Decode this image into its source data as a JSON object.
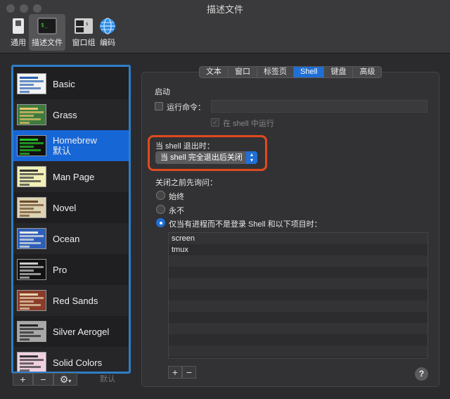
{
  "window": {
    "title": "描述文件"
  },
  "toolbar": [
    {
      "label": "通用",
      "icon": "general-switch-icon"
    },
    {
      "label": "描述文件",
      "icon": "terminal-profile-icon",
      "active": true
    },
    {
      "label": "窗口组",
      "icon": "window-group-icon"
    },
    {
      "label": "编码",
      "icon": "globe-icon"
    }
  ],
  "profiles": [
    {
      "name": "Basic",
      "bg": "#f2f2f2",
      "fg": "#2a5fb0"
    },
    {
      "name": "Grass",
      "bg": "#3f7a3f",
      "fg": "#e8c46a"
    },
    {
      "name": "Homebrew",
      "sub": "默认",
      "bg": "#111111",
      "fg": "#29c429",
      "selected": true
    },
    {
      "name": "Man Page",
      "bg": "#f2efb8",
      "fg": "#333333"
    },
    {
      "name": "Novel",
      "bg": "#ddd2b4",
      "fg": "#6b4a2a"
    },
    {
      "name": "Ocean",
      "bg": "#2e5fb8",
      "fg": "#e8e8e8"
    },
    {
      "name": "Pro",
      "bg": "#111111",
      "fg": "#cccccc"
    },
    {
      "name": "Red Sands",
      "bg": "#8a3b2a",
      "fg": "#e8d5b0"
    },
    {
      "name": "Silver Aerogel",
      "bg": "#a8a8a8",
      "fg": "#222222"
    },
    {
      "name": "Solid Colors",
      "bg": "#f0d0e0",
      "fg": "#333333"
    }
  ],
  "list_actions": {
    "add": "+",
    "remove": "−",
    "gear": "⚙",
    "default": "默认"
  },
  "tabs": [
    {
      "label": "文本"
    },
    {
      "label": "窗口"
    },
    {
      "label": "标签页"
    },
    {
      "label": "Shell",
      "active": true
    },
    {
      "label": "键盘"
    },
    {
      "label": "高级"
    }
  ],
  "startup": {
    "heading": "启动",
    "run_command_label": "运行命令：",
    "run_command_value": "",
    "run_in_shell_label": "在 shell 中运行"
  },
  "on_exit": {
    "heading": "当 shell 退出时：",
    "selected": "当 shell 完全退出后关闭"
  },
  "ask_before_close": {
    "heading": "关闭之前先询问：",
    "options": [
      "始终",
      "永不",
      "仅当有进程而不是登录 Shell 和以下项目时："
    ],
    "selected_index": 2,
    "processes": [
      "screen",
      "tmux"
    ]
  },
  "table_actions": {
    "add": "+",
    "remove": "−"
  },
  "help": "?",
  "colors": {
    "accent": "#1f6fd6",
    "highlight": "#e04a1e",
    "list_border": "#2f7ec6"
  }
}
